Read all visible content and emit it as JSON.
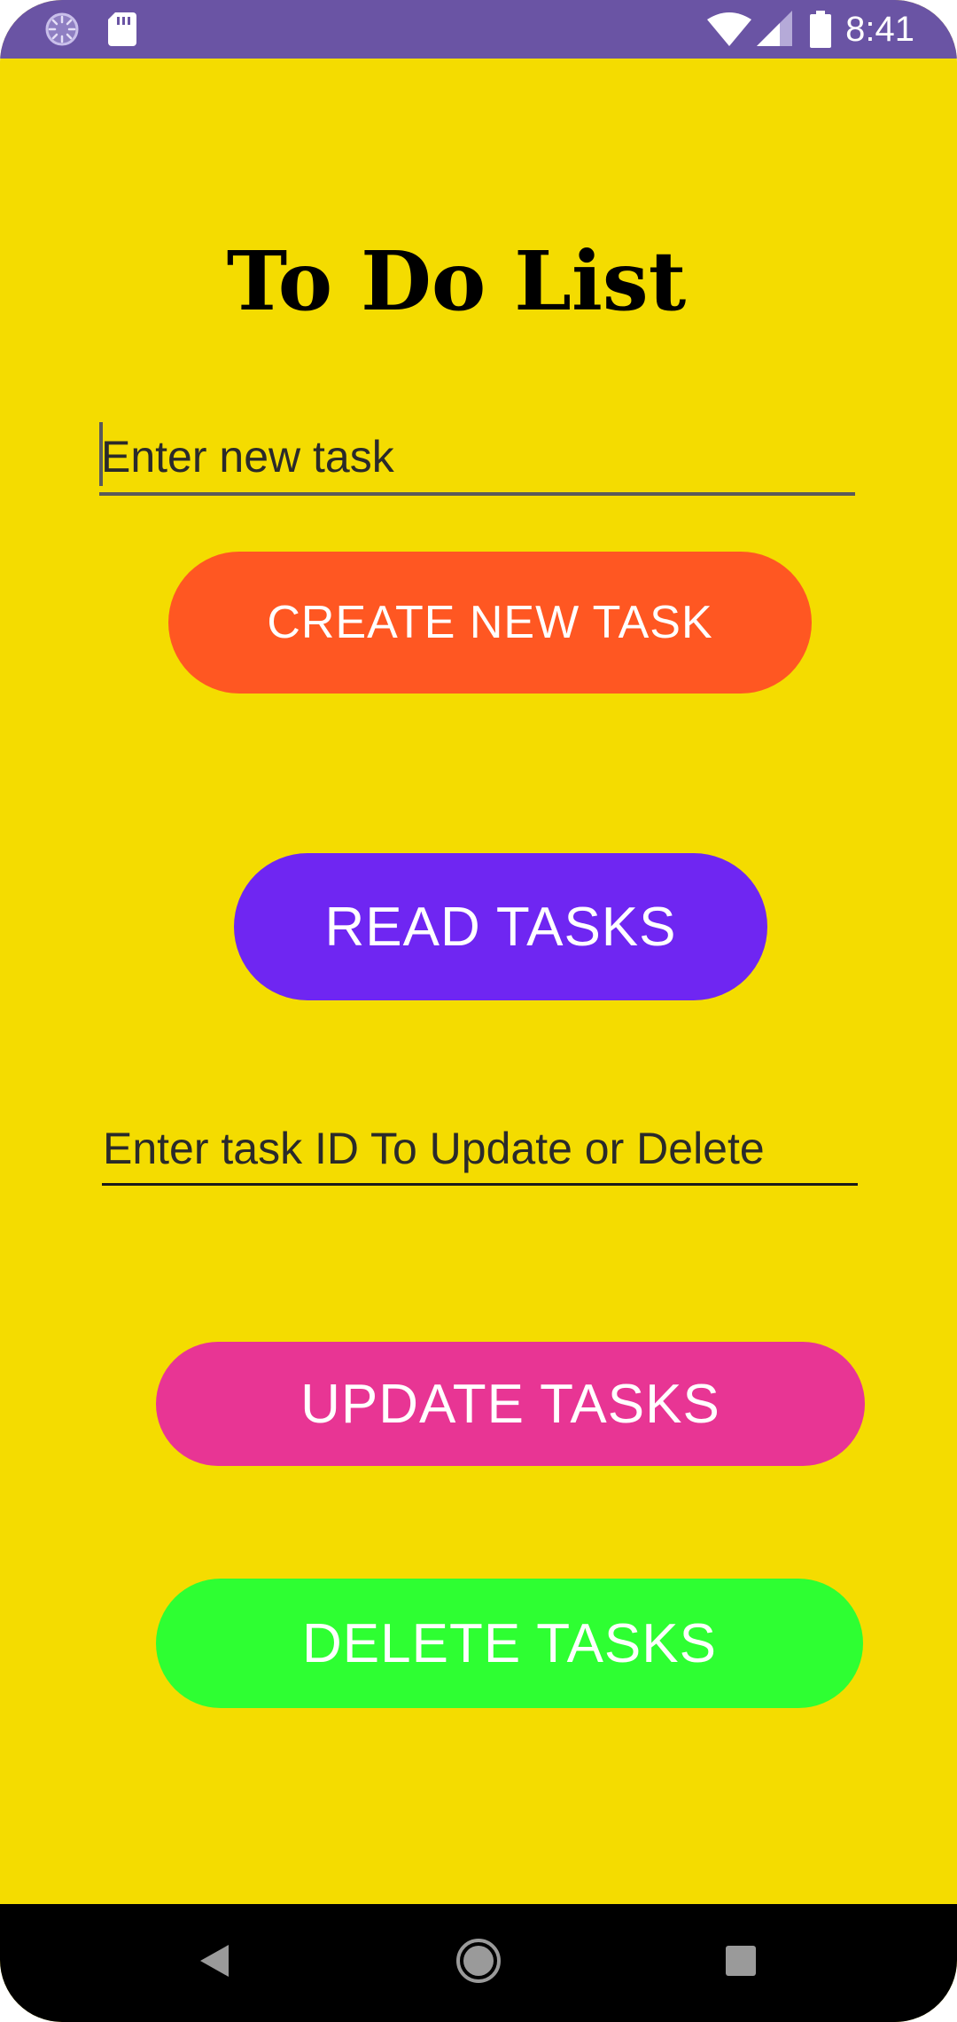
{
  "status_bar": {
    "time": "8:41",
    "icons": [
      "loading-spinner-icon",
      "sd-card-icon",
      "wifi-icon",
      "cellular-signal-icon",
      "battery-icon"
    ],
    "color": "#6A54A4"
  },
  "app": {
    "title": "To Do List",
    "background_color": "#F4DC00"
  },
  "new_task_input": {
    "placeholder": "Enter new task",
    "value": ""
  },
  "create_button": {
    "label": "CREATE NEW TASK",
    "color": "#FF5722"
  },
  "read_button": {
    "label": "READ TASKS",
    "color": "#6F26F2"
  },
  "task_id_input": {
    "placeholder": "Enter task ID To Update or Delete",
    "value": ""
  },
  "update_button": {
    "label": "UPDATE TASKS",
    "color": "#E83594"
  },
  "delete_button": {
    "label": "DELETE TASKS",
    "color": "#2EFF32"
  },
  "nav_bar": {
    "icons": [
      "back-icon",
      "home-icon",
      "recents-icon"
    ]
  }
}
